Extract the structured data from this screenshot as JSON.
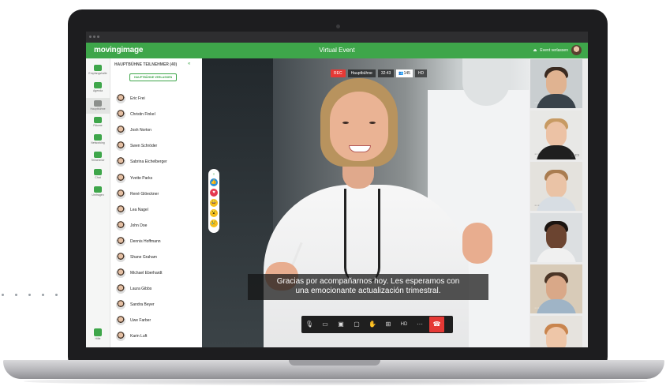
{
  "app": {
    "logo": "movingimage",
    "event_title": "Virtual Event",
    "user_action": "Event verlassen"
  },
  "nav": {
    "items": [
      {
        "label": "Empfangshalle",
        "icon": "reception-icon"
      },
      {
        "label": "Agenda",
        "icon": "calendar-icon"
      },
      {
        "label": "Hauptbühne",
        "icon": "stage-icon"
      },
      {
        "label": "Räume",
        "icon": "rooms-icon"
      },
      {
        "label": "Networking",
        "icon": "networking-icon"
      },
      {
        "label": "Teilnehmer",
        "icon": "attendee-icon"
      },
      {
        "label": "Chat",
        "icon": "chat-icon"
      },
      {
        "label": "Umfragen",
        "icon": "poll-icon"
      }
    ],
    "bottom_label": "Hilfe"
  },
  "participants": {
    "header": "HAUPTBÜHNE TEILNEHMER (40)",
    "leave_button": "HAUPTBÜHNE VERLASSEN",
    "names": [
      "Eric Frei",
      "Christin Finkel",
      "Josh Norton",
      "Swen Schröder",
      "Sabrina Eichelberger",
      "Yvette Parks",
      "René Glöeckner",
      "Lea Nagel",
      "John Doe",
      "Dennis Hoffmann",
      "Shane Graham",
      "Michael Eberhardt",
      "Laura Gibbs",
      "Sandra Beyer",
      "Uwe Farber",
      "Karin Luft"
    ]
  },
  "stream": {
    "rec": "REC",
    "stage": "Hauptbühne",
    "duration": "32:43",
    "viewers": "145",
    "quality": "HD"
  },
  "subtitle": {
    "line1": "Gracias por acompañarnos hoy. Les esperamos con",
    "line2": "una emocionante actualización trimestral."
  },
  "controls": {
    "hd_label": "HD",
    "more_label": "···"
  },
  "colors": {
    "brand_green": "#3ea64a",
    "rec_red": "#e53935"
  }
}
